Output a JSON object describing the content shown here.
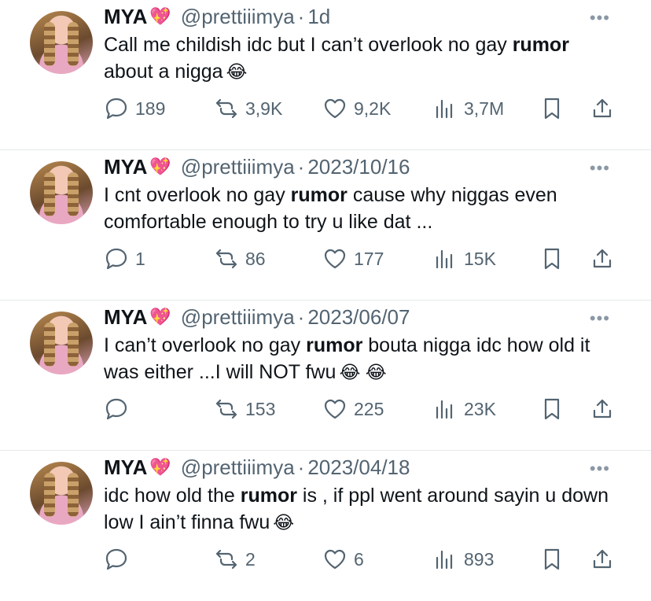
{
  "tweets": [
    {
      "name": "MYA",
      "handle": "@prettiiimya",
      "time": "1d",
      "text_before": "Call me childish idc but I can’t overlook no gay ",
      "bold": "rumor",
      "text_after": " about a nigga",
      "emoji": "😂",
      "replies": "189",
      "retweets": "3,9K",
      "likes": "9,2K",
      "views": "3,7M"
    },
    {
      "name": "MYA",
      "handle": "@prettiiimya",
      "time": "2023/10/16",
      "text_before": "I cnt overlook no gay ",
      "bold": "rumor",
      "text_after": " cause why niggas even comfortable enough to try u like dat ...",
      "emoji": "",
      "replies": "1",
      "retweets": "86",
      "likes": "177",
      "views": "15K"
    },
    {
      "name": "MYA",
      "handle": "@prettiiimya",
      "time": "2023/06/07",
      "text_before": "I can’t overlook no gay ",
      "bold": "rumor",
      "text_after": " bouta nigga idc how old it was either ...I will NOT fwu",
      "emoji": "😂 😂",
      "replies": "",
      "retweets": "153",
      "likes": "225",
      "views": "23K"
    },
    {
      "name": "MYA",
      "handle": "@prettiiimya",
      "time": "2023/04/18",
      "text_before": "idc how old the ",
      "bold": "rumor",
      "text_after": " is , if ppl went around sayin u down low I ain’t finna fwu",
      "emoji": "😂",
      "replies": "",
      "retweets": "2",
      "likes": "6",
      "views": "893"
    }
  ],
  "icons": {
    "reply": "speech-bubble-icon",
    "retweet": "retweet-icon",
    "like": "heart-outline-icon",
    "views": "bar-chart-icon",
    "bookmark": "bookmark-icon",
    "share": "share-upload-icon",
    "verified_heart": "heart-with-ribbon-emoji"
  },
  "colors": {
    "secondary_text": "#536471",
    "divider": "#e6e9ea",
    "heart": "#e0245e"
  },
  "ui": {
    "separator": "·",
    "more": "•••",
    "heart_emoji": "💖"
  }
}
